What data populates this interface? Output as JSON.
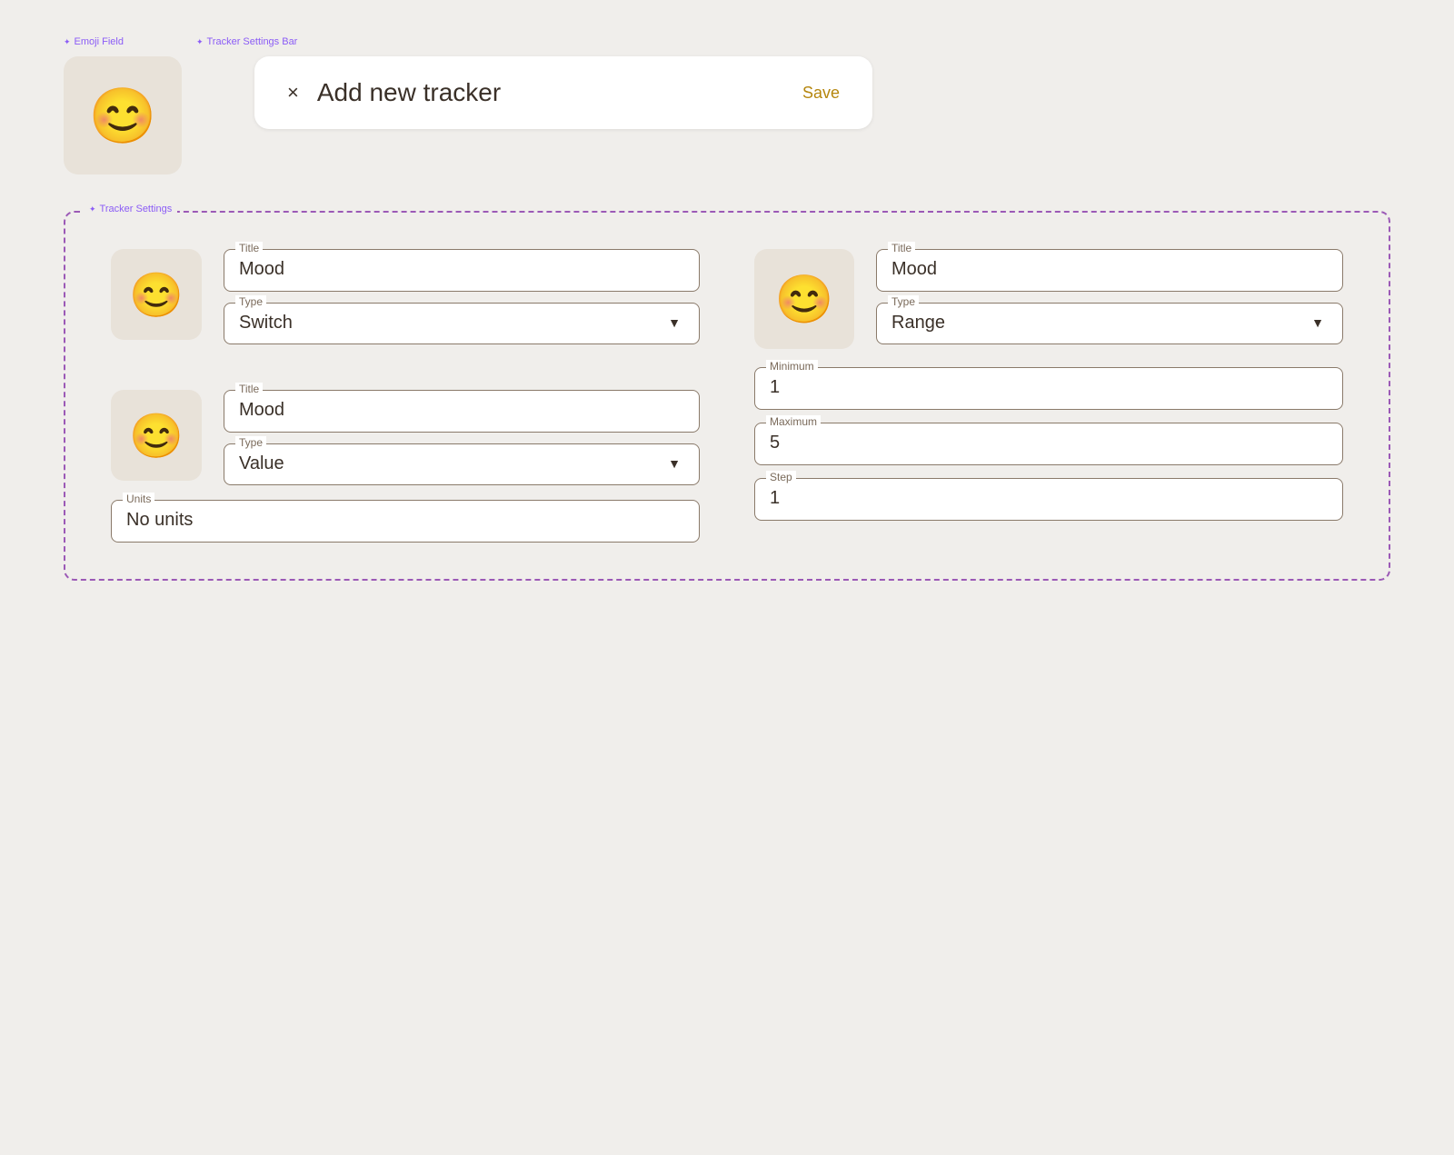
{
  "annotations": {
    "emoji_field_label": "Emoji Field",
    "tracker_settings_bar_label": "Tracker Settings Bar",
    "tracker_settings_label": "Tracker Settings"
  },
  "header": {
    "close_label": "×",
    "title": "Add new tracker",
    "save_label": "Save"
  },
  "emoji_top": "😊",
  "tracker_items": [
    {
      "emoji": "😊",
      "title_label": "Title",
      "title_value": "Mood",
      "type_label": "Type",
      "type_value": "Switch",
      "type_options": [
        "Switch",
        "Value",
        "Range"
      ]
    },
    {
      "emoji": "😊",
      "title_label": "Title",
      "title_value": "Mood",
      "type_label": "Type",
      "type_value": "Value",
      "type_options": [
        "Switch",
        "Value",
        "Range"
      ],
      "units_label": "Units",
      "units_value": "No units"
    }
  ],
  "right_tracker": {
    "emoji": "😊",
    "title_label": "Title",
    "title_value": "Mood",
    "type_label": "Type",
    "type_value": "Range",
    "type_options": [
      "Switch",
      "Value",
      "Range"
    ],
    "minimum_label": "Minimum",
    "minimum_value": "1",
    "maximum_label": "Maximum",
    "maximum_value": "5",
    "step_label": "Step",
    "step_value": "1"
  }
}
